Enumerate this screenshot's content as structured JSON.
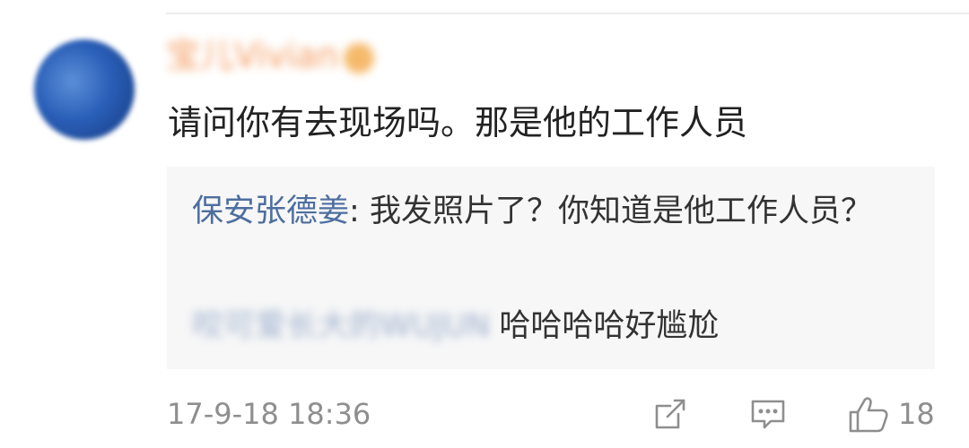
{
  "comment": {
    "username": "宝儿Vivian",
    "text": "请问你有去现场吗。那是他的工作人员",
    "timestamp": "17-9-18 18:36",
    "like_count": "18",
    "icons": {
      "share": "share-icon",
      "reply": "comment-icon",
      "like": "thumbs-up-icon",
      "badge": "verified-badge-icon"
    }
  },
  "replies": [
    {
      "author": "保安张德姜",
      "separator": ": ",
      "text": "我发照片了？你知道是他工作人员？"
    },
    {
      "author": "咬可爱长大的WUJUN",
      "text": "哈哈哈哈好尴尬"
    }
  ],
  "colors": {
    "link": "#4d6e9f",
    "username": "#f07a2a",
    "text": "#222222",
    "muted": "#8e8e8e",
    "reply_bg": "#f7f7f7"
  }
}
